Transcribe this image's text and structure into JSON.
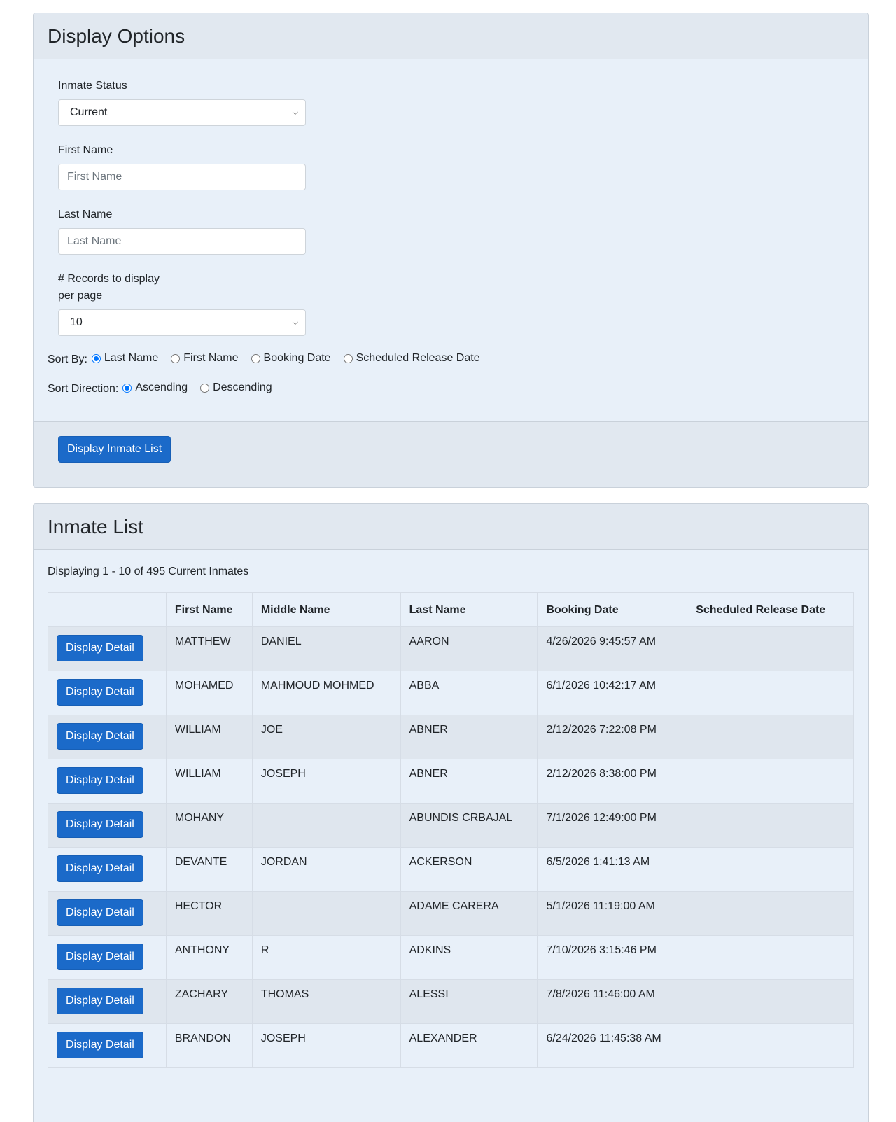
{
  "display_options": {
    "title": "Display Options",
    "inmate_status": {
      "label": "Inmate Status",
      "value": "Current"
    },
    "first_name": {
      "label": "First Name",
      "placeholder": "First Name"
    },
    "last_name": {
      "label": "Last Name",
      "placeholder": "Last Name"
    },
    "records_per_page": {
      "label_line1": "# Records to display",
      "label_line2": "per page",
      "value": "10"
    },
    "sort_by": {
      "label": "Sort By:",
      "options": [
        "Last Name",
        "First Name",
        "Booking Date",
        "Scheduled Release Date"
      ],
      "selected": "Last Name"
    },
    "sort_direction": {
      "label": "Sort Direction:",
      "options": [
        "Ascending",
        "Descending"
      ],
      "selected": "Ascending"
    },
    "submit_label": "Display Inmate List"
  },
  "inmate_list": {
    "title": "Inmate List",
    "summary": "Displaying 1 - 10 of 495 Current Inmates",
    "columns": [
      "",
      "First Name",
      "Middle Name",
      "Last Name",
      "Booking Date",
      "Scheduled Release Date"
    ],
    "detail_button_label": "Display Detail",
    "rows": [
      {
        "first": "MATTHEW",
        "middle": "DANIEL",
        "last": "AARON",
        "booking": "4/26/2026 9:45:57 AM",
        "release": ""
      },
      {
        "first": "MOHAMED",
        "middle": "MAHMOUD MOHMED",
        "last": "ABBA",
        "booking": "6/1/2026 10:42:17 AM",
        "release": ""
      },
      {
        "first": "WILLIAM",
        "middle": "JOE",
        "last": "ABNER",
        "booking": "2/12/2026 7:22:08 PM",
        "release": ""
      },
      {
        "first": "WILLIAM",
        "middle": "JOSEPH",
        "last": "ABNER",
        "booking": "2/12/2026 8:38:00 PM",
        "release": ""
      },
      {
        "first": "MOHANY",
        "middle": "",
        "last": "ABUNDIS CRBAJAL",
        "booking": "7/1/2026 12:49:00 PM",
        "release": ""
      },
      {
        "first": "DEVANTE",
        "middle": "JORDAN",
        "last": "ACKERSON",
        "booking": "6/5/2026 1:41:13 AM",
        "release": ""
      },
      {
        "first": "HECTOR",
        "middle": "",
        "last": "ADAME CARERA",
        "booking": "5/1/2026 11:19:00 AM",
        "release": ""
      },
      {
        "first": "ANTHONY",
        "middle": "R",
        "last": "ADKINS",
        "booking": "7/10/2026 3:15:46 PM",
        "release": ""
      },
      {
        "first": "ZACHARY",
        "middle": "THOMAS",
        "last": "ALESSI",
        "booking": "7/8/2026 11:46:00 AM",
        "release": ""
      },
      {
        "first": "BRANDON",
        "middle": "JOSEPH",
        "last": "ALEXANDER",
        "booking": "6/24/2026 11:45:38 AM",
        "release": ""
      }
    ],
    "pager": {
      "first": "<<",
      "prev": "<",
      "next": ">",
      "last": ">>"
    }
  }
}
